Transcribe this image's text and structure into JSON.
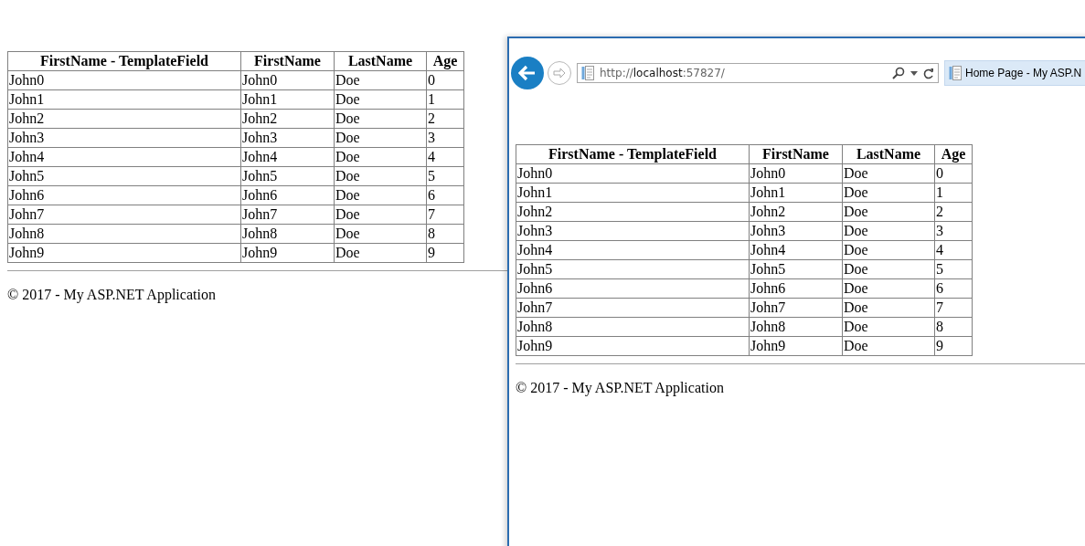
{
  "page": {
    "table": {
      "columns": [
        "FirstName - TemplateField",
        "FirstName",
        "LastName",
        "Age"
      ],
      "rows": [
        [
          "John0",
          "John0",
          "Doe",
          "0"
        ],
        [
          "John1",
          "John1",
          "Doe",
          "1"
        ],
        [
          "John2",
          "John2",
          "Doe",
          "2"
        ],
        [
          "John3",
          "John3",
          "Doe",
          "3"
        ],
        [
          "John4",
          "John4",
          "Doe",
          "4"
        ],
        [
          "John5",
          "John5",
          "Doe",
          "5"
        ],
        [
          "John6",
          "John6",
          "Doe",
          "6"
        ],
        [
          "John7",
          "John7",
          "Doe",
          "7"
        ],
        [
          "John8",
          "John8",
          "Doe",
          "8"
        ],
        [
          "John9",
          "John9",
          "Doe",
          "9"
        ]
      ]
    },
    "footer": "© 2017 - My ASP.NET Application"
  },
  "browser": {
    "address_bar": {
      "url": "http://**localhost**:57827/"
    },
    "tab": {
      "title": "Home Page - My ASP.N"
    },
    "page": {
      "table": {
        "columns": [
          "FirstName - TemplateField",
          "FirstName",
          "LastName",
          "Age"
        ],
        "rows": [
          [
            "John0",
            "John0",
            "Doe",
            "0"
          ],
          [
            "John1",
            "John1",
            "Doe",
            "1"
          ],
          [
            "John2",
            "John2",
            "Doe",
            "2"
          ],
          [
            "John3",
            "John3",
            "Doe",
            "3"
          ],
          [
            "John4",
            "John4",
            "Doe",
            "4"
          ],
          [
            "John5",
            "John5",
            "Doe",
            "5"
          ],
          [
            "John6",
            "John6",
            "Doe",
            "6"
          ],
          [
            "John7",
            "John7",
            "Doe",
            "7"
          ],
          [
            "John8",
            "John8",
            "Doe",
            "8"
          ],
          [
            "John9",
            "John9",
            "Doe",
            "9"
          ]
        ]
      },
      "footer": "© 2017 - My ASP.NET Application"
    }
  }
}
